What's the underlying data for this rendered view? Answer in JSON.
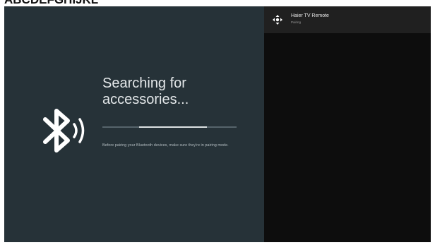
{
  "caption": "ABCDEFGHIJKL",
  "search": {
    "title_line1": "Searching for",
    "title_line2": "accessories...",
    "hint": "Before pairing your Bluetooth devices, make sure they're in pairing mode."
  },
  "progress": {
    "indeterminate": true
  },
  "device": {
    "name": "Haier TV Remote",
    "status": "Pairing",
    "icon": "remote-dpad-icon"
  },
  "icons": {
    "bluetooth": "bluetooth-searching-icon"
  },
  "colors": {
    "left_panel_bg": "#263238",
    "right_panel_bg": "#0d0d0d",
    "device_row_bg": "#202020",
    "text_primary": "#e3e7e9",
    "progress_track": "#56646b",
    "progress_fill": "#dde2e4"
  }
}
